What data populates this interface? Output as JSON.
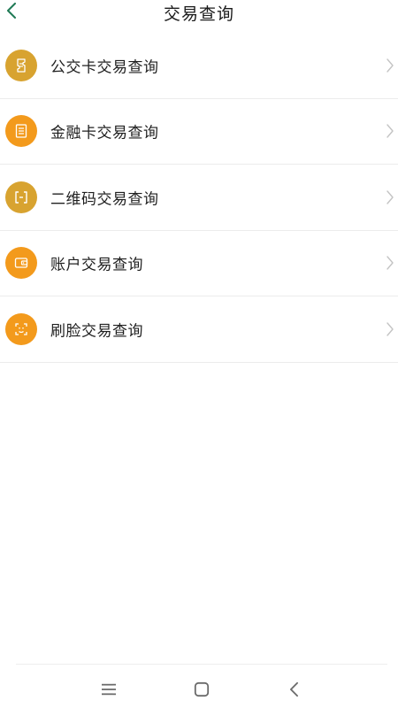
{
  "header": {
    "title": "交易查询",
    "back_icon": "chevron-left-icon"
  },
  "colors": {
    "accent_green": "#1f7a55",
    "icon_gold": "#d8a330",
    "icon_orange": "#f39a1c",
    "chevron": "#c4c4c4",
    "divider": "#ececec"
  },
  "menu": {
    "items": [
      {
        "label": "公交卡交易查询",
        "icon": "bus-card-icon",
        "color": "#d8a330"
      },
      {
        "label": "金融卡交易查询",
        "icon": "finance-card-icon",
        "color": "#f39a1c"
      },
      {
        "label": "二维码交易查询",
        "icon": "qr-code-icon",
        "color": "#d8a330"
      },
      {
        "label": "账户交易查询",
        "icon": "wallet-icon",
        "color": "#f39a1c"
      },
      {
        "label": "刷脸交易查询",
        "icon": "face-scan-icon",
        "color": "#f39a1c"
      }
    ]
  },
  "navbar": {
    "menu_icon": "menu-icon",
    "home_icon": "home-icon",
    "back_icon": "back-icon"
  }
}
